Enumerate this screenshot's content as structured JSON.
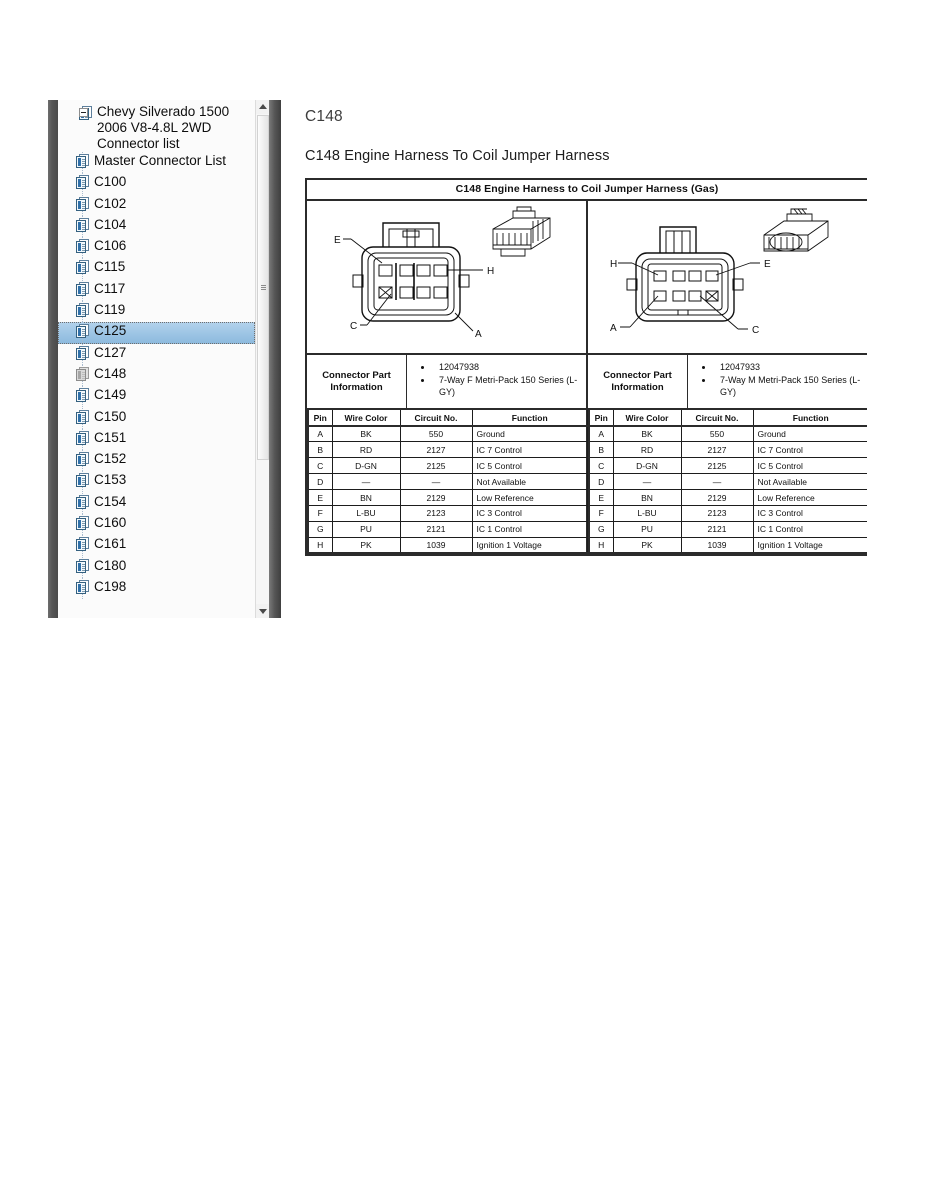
{
  "sidebar": {
    "root": {
      "label": "Chevy Silverado 1500 2006 V8-4.8L 2WD Connector list",
      "icon": "document-icon",
      "expander": "collapse-minus-icon"
    },
    "items": [
      {
        "label": "Master Connector List",
        "icon": "document-icon",
        "state": "normal"
      },
      {
        "label": "C100",
        "icon": "document-icon",
        "state": "normal"
      },
      {
        "label": "C102",
        "icon": "document-icon",
        "state": "normal"
      },
      {
        "label": "C104",
        "icon": "document-icon",
        "state": "normal"
      },
      {
        "label": "C106",
        "icon": "document-icon",
        "state": "normal"
      },
      {
        "label": "C115",
        "icon": "document-icon",
        "state": "normal"
      },
      {
        "label": "C117",
        "icon": "document-icon",
        "state": "normal"
      },
      {
        "label": "C119",
        "icon": "document-icon",
        "state": "normal"
      },
      {
        "label": "C125",
        "icon": "document-icon",
        "state": "selected"
      },
      {
        "label": "C127",
        "icon": "document-icon",
        "state": "normal"
      },
      {
        "label": "C148",
        "icon": "document-icon",
        "state": "dim"
      },
      {
        "label": "C149",
        "icon": "document-icon",
        "state": "normal"
      },
      {
        "label": "C150",
        "icon": "document-icon",
        "state": "normal"
      },
      {
        "label": "C151",
        "icon": "document-icon",
        "state": "normal"
      },
      {
        "label": "C152",
        "icon": "document-icon",
        "state": "normal"
      },
      {
        "label": "C153",
        "icon": "document-icon",
        "state": "normal"
      },
      {
        "label": "C154",
        "icon": "document-icon",
        "state": "normal"
      },
      {
        "label": "C160",
        "icon": "document-icon",
        "state": "normal"
      },
      {
        "label": "C161",
        "icon": "document-icon",
        "state": "normal"
      },
      {
        "label": "C180",
        "icon": "document-icon",
        "state": "normal"
      },
      {
        "label": "C198",
        "icon": "document-icon",
        "state": "normal"
      }
    ],
    "scrollbar": {
      "up_arrow": "scroll-up-arrow-icon",
      "down_arrow": "scroll-down-arrow-icon",
      "thumb": "scrollbar-thumb"
    }
  },
  "content": {
    "connector_id": "C148",
    "title": "C148 Engine Harness To Coil Jumper Harness",
    "block_title": "C148 Engine Harness to Coil Jumper Harness (Gas)",
    "halves": [
      {
        "side": "female",
        "diagram_callouts": [
          "E",
          "H",
          "C",
          "A"
        ],
        "connector_part_information_label": "Connector Part Information",
        "connector_part_information": [
          "12047938",
          "7-Way F Metri-Pack 150 Series (L-GY)"
        ],
        "table": {
          "headers": [
            "Pin",
            "Wire Color",
            "Circuit No.",
            "Function"
          ],
          "rows": [
            [
              "A",
              "BK",
              "550",
              "Ground"
            ],
            [
              "B",
              "RD",
              "2127",
              "IC 7 Control"
            ],
            [
              "C",
              "D-GN",
              "2125",
              "IC 5 Control"
            ],
            [
              "D",
              "—",
              "—",
              "Not Available"
            ],
            [
              "E",
              "BN",
              "2129",
              "Low Reference"
            ],
            [
              "F",
              "L-BU",
              "2123",
              "IC 3 Control"
            ],
            [
              "G",
              "PU",
              "2121",
              "IC 1 Control"
            ],
            [
              "H",
              "PK",
              "1039",
              "Ignition 1 Voltage"
            ]
          ]
        }
      },
      {
        "side": "male",
        "diagram_callouts": [
          "H",
          "E",
          "A",
          "C"
        ],
        "connector_part_information_label": "Connector Part Information",
        "connector_part_information": [
          "12047933",
          "7-Way M Metri-Pack 150 Series (L-GY)"
        ],
        "table": {
          "headers": [
            "Pin",
            "Wire Color",
            "Circuit No.",
            "Function"
          ],
          "rows": [
            [
              "A",
              "BK",
              "550",
              "Ground"
            ],
            [
              "B",
              "RD",
              "2127",
              "IC 7 Control"
            ],
            [
              "C",
              "D-GN",
              "2125",
              "IC 5 Control"
            ],
            [
              "D",
              "—",
              "—",
              "Not Available"
            ],
            [
              "E",
              "BN",
              "2129",
              "Low Reference"
            ],
            [
              "F",
              "L-BU",
              "2123",
              "IC 3 Control"
            ],
            [
              "G",
              "PU",
              "2121",
              "IC 1 Control"
            ],
            [
              "H",
              "PK",
              "1039",
              "Ignition 1 Voltage"
            ]
          ]
        }
      }
    ]
  },
  "colors": {
    "selection_blue": "#9cc4e4",
    "panel_edge": "#565656",
    "rule_black": "#2b2b2b",
    "icon_blue": "#2f6fa8"
  }
}
